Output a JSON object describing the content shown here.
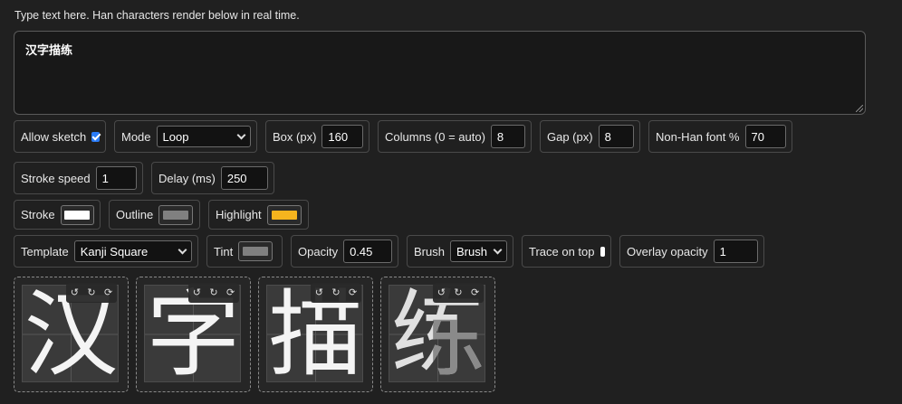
{
  "hint": "Type text here. Han characters render below in real time.",
  "text_value": "汉字描练",
  "row1": {
    "allow_sketch": {
      "label": "Allow sketch",
      "checked": true
    },
    "mode": {
      "label": "Mode",
      "value": "Loop"
    },
    "box": {
      "label": "Box (px)",
      "value": "160"
    },
    "columns": {
      "label": "Columns (0 = auto)",
      "value": "8"
    },
    "gap": {
      "label": "Gap (px)",
      "value": "8"
    },
    "nonhan": {
      "label": "Non-Han font %",
      "value": "70"
    }
  },
  "row2": {
    "stroke_speed": {
      "label": "Stroke speed",
      "value": "1"
    },
    "delay": {
      "label": "Delay (ms)",
      "value": "250"
    }
  },
  "row3": {
    "stroke": {
      "label": "Stroke",
      "color": "#ffffff"
    },
    "outline": {
      "label": "Outline",
      "color": "#808080"
    },
    "highlight": {
      "label": "Highlight",
      "color": "#f5b41e"
    }
  },
  "row4": {
    "template": {
      "label": "Template",
      "value": "Kanji Square"
    },
    "tint": {
      "label": "Tint",
      "color": "#808080"
    },
    "opacity": {
      "label": "Opacity",
      "value": "0.45"
    },
    "brush": {
      "label": "Brush",
      "value": "Brush"
    },
    "trace_on_top": {
      "label": "Trace on top",
      "checked": false
    },
    "overlay_opacity": {
      "label": "Overlay opacity",
      "value": "1"
    }
  },
  "cells": [
    {
      "char": "汉"
    },
    {
      "char": "字"
    },
    {
      "char": "描"
    },
    {
      "char": "练"
    }
  ],
  "cell_tools": {
    "undo": "↺",
    "redo": "↻",
    "replay": "⟳"
  }
}
